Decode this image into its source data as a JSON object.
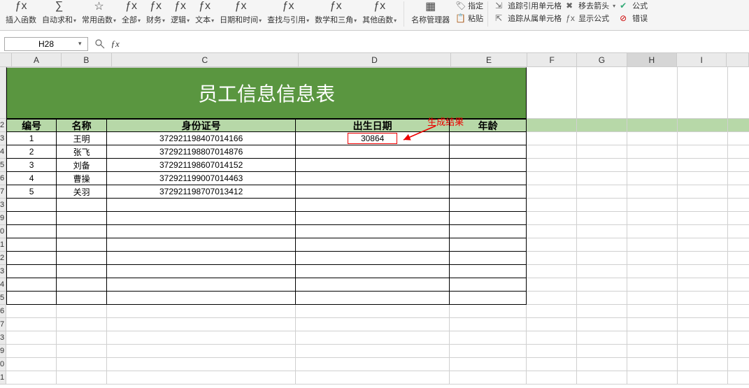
{
  "ribbon": {
    "insert_fn": "插入函数",
    "autosum": "自动求和",
    "common_fn": "常用函数",
    "all": "全部",
    "finance": "财务",
    "logic": "逻辑",
    "text": "文本",
    "datetime": "日期和时间",
    "lookup": "查找与引用",
    "math": "数学和三角",
    "other_fn": "其他函数",
    "name_mgr": "名称管理器",
    "define": "指定",
    "paste": "粘贴",
    "trace_prec": "追踪引用单元格",
    "trace_dep": "追踪从属单元格",
    "remove_arrows": "移去箭头",
    "show_formula": "显示公式",
    "error": "错误",
    "formula": "公式"
  },
  "namebox": {
    "cell": "H28"
  },
  "annotation": {
    "label": "生成结果"
  },
  "columns": [
    "A",
    "B",
    "C",
    "D",
    "E",
    "F",
    "G",
    "H",
    "I"
  ],
  "table": {
    "title": "员工信息信息表",
    "headers": {
      "a": "编号",
      "b": "名称",
      "c": "身份证号",
      "d": "出生日期",
      "e": "年龄"
    },
    "rows": [
      {
        "idx": "1",
        "name": "王明",
        "id": "372921198407014166",
        "dob": "30864"
      },
      {
        "idx": "2",
        "name": "张飞",
        "id": "372921198807014876",
        "dob": ""
      },
      {
        "idx": "3",
        "name": "刘备",
        "id": "372921198607014152",
        "dob": ""
      },
      {
        "idx": "4",
        "name": "曹操",
        "id": "372921199007014463",
        "dob": ""
      },
      {
        "idx": "5",
        "name": "关羽",
        "id": "372921198707013412",
        "dob": ""
      }
    ]
  }
}
